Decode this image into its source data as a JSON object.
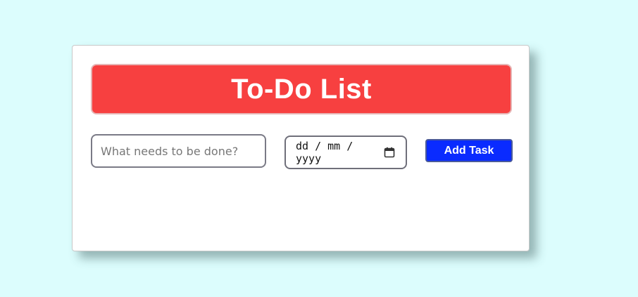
{
  "app": {
    "title": "To-Do List"
  },
  "form": {
    "task_placeholder": "What needs to be done?",
    "task_value": "",
    "date_placeholder": "dd / mm / yyyy",
    "add_button_label": "Add Task"
  },
  "icons": {
    "date_picker": "calendar-icon"
  },
  "colors": {
    "page_background": "#dcfdfd",
    "header_background": "#f74040",
    "button_background": "#0a2bff",
    "card_background": "#ffffff"
  }
}
